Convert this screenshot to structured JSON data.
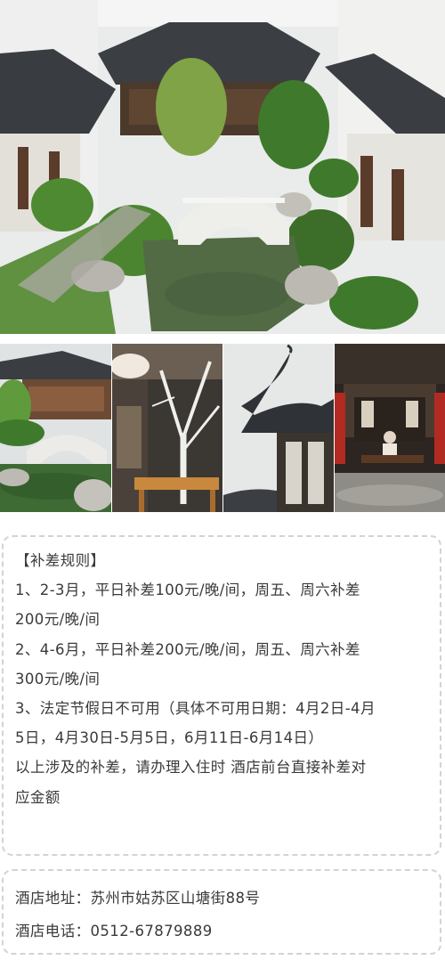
{
  "images": {
    "hero": {
      "icon": "courtyard-garden-photo"
    },
    "thumbnails": [
      {
        "icon": "bridge-pond-photo"
      },
      {
        "icon": "tea-room-tree-photo"
      },
      {
        "icon": "upturned-eave-photo"
      },
      {
        "icon": "guqin-player-hall-photo"
      }
    ]
  },
  "rules": {
    "title": "【补差规则】",
    "lines": [
      "1、2-3月，平日补差100元/晚/间，周五、周六补差",
      "200元/晚/间",
      "2、4-6月，平日补差200元/晚/间，周五、周六补差",
      "300元/晚/间",
      "3、法定节假日不可用（具体不可用日期：4月2日-4月",
      "5日，4月30日-5月5日，6月11日-6月14日）",
      "以上涉及的补差，请办理入住时 酒店前台直接补差对",
      "应金额"
    ]
  },
  "hotel": {
    "address": "酒店地址：苏州市姑苏区山塘街88号",
    "phone": "酒店电话：0512-67879889"
  },
  "colors": {
    "border": "#d3d3d3",
    "text": "#3a3a3a"
  }
}
